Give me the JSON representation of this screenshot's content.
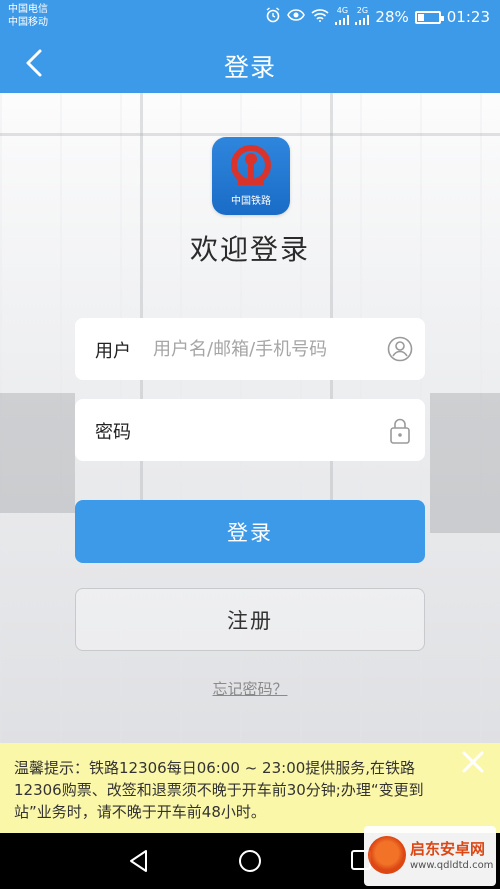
{
  "status_bar": {
    "carrier_1": "中国电信",
    "carrier_2": "中国移动",
    "network_1": "4G",
    "network_2": "2G",
    "battery": "28%",
    "time": "01:23"
  },
  "header": {
    "title": "登录"
  },
  "logo": {
    "text": "中国铁路"
  },
  "welcome": "欢迎登录",
  "form": {
    "user_label": "用户",
    "user_placeholder": "用户名/邮箱/手机号码",
    "user_value": "",
    "pass_label": "密码",
    "pass_value": ""
  },
  "buttons": {
    "login": "登录",
    "register": "注册",
    "forgot": "忘记密码？"
  },
  "notice": {
    "text": "温馨提示：铁路12306每日06:00 ~ 23:00提供服务,在铁路12306购票、改签和退票须不晚于开车前30分钟;办理“变更到站”业务时，请不晚于开车前48小时。"
  },
  "watermark": {
    "title": "启东安卓网",
    "url": "www.qdldtd.com"
  },
  "colors": {
    "primary": "#3d9ae8",
    "notice_bg": "#fbf7a8",
    "logo_red": "#d9332b"
  },
  "icons": {
    "back": "chevron-left-icon",
    "user": "user-circle-icon",
    "lock": "lock-icon",
    "close": "close-icon"
  }
}
